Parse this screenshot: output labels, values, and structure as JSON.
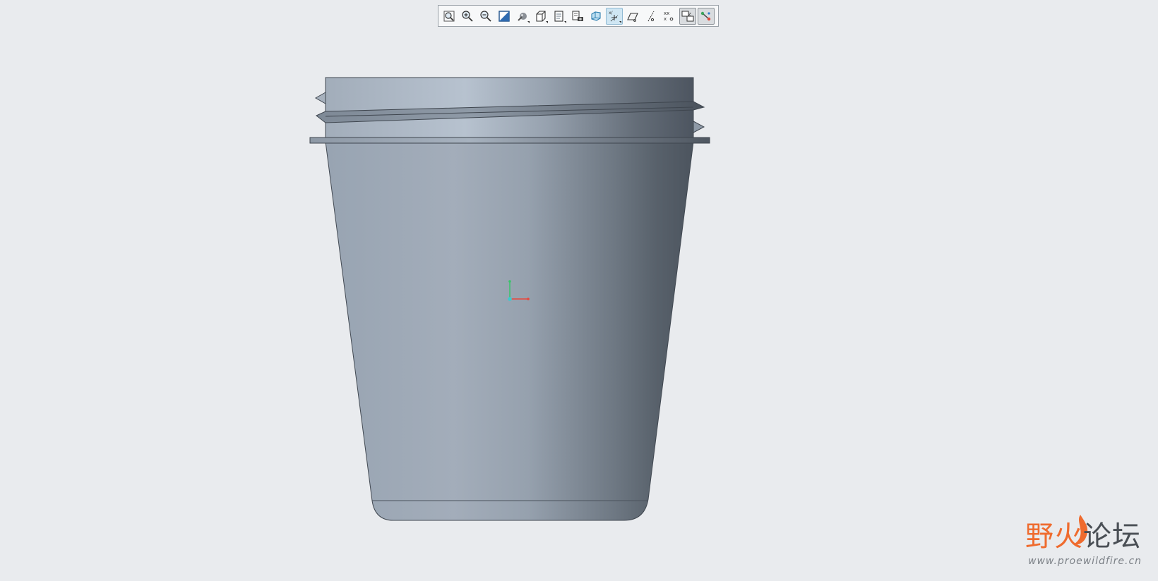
{
  "toolbar": {
    "buttons": [
      {
        "icon": "refit-icon",
        "active": false,
        "dropdown": false
      },
      {
        "icon": "zoom-in-icon",
        "active": false,
        "dropdown": false
      },
      {
        "icon": "zoom-out-icon",
        "active": false,
        "dropdown": false
      },
      {
        "icon": "repaint-icon",
        "active": false,
        "dropdown": false
      },
      {
        "icon": "display-style-icon",
        "active": false,
        "dropdown": true
      },
      {
        "icon": "saved-orientations-icon",
        "active": false,
        "dropdown": true
      },
      {
        "icon": "view-manager-icon",
        "active": false,
        "dropdown": true
      },
      {
        "icon": "perspective-view-icon",
        "active": false,
        "dropdown": false
      },
      {
        "icon": "section-view-icon",
        "active": false,
        "dropdown": false
      },
      {
        "icon": "datum-display-icon",
        "active": true,
        "dropdown": true
      },
      {
        "icon": "plane-display-icon",
        "active": false,
        "dropdown": false
      },
      {
        "icon": "axis-display-icon",
        "active": false,
        "dropdown": false
      },
      {
        "icon": "point-display-icon",
        "active": false,
        "dropdown": false
      },
      {
        "icon": "csys-display-icon",
        "active": false,
        "dropdown": false
      },
      {
        "icon": "spin-center-icon",
        "active": false,
        "dropdown": false
      }
    ]
  },
  "model": {
    "name": "cup-model",
    "colors": {
      "body_light": "#b3becb",
      "body_mid": "#99a4b1",
      "body_dark": "#525a64",
      "edge": "#3f464f"
    }
  },
  "csys": {
    "x_color": "#e8463c",
    "y_color": "#39c46a",
    "origin_color": "#3ec9cf"
  },
  "watermark": {
    "title_part1": "野火",
    "title_part2": "论坛",
    "url": "www.proewildfire.cn",
    "accent_color": "#ef6b2e"
  }
}
